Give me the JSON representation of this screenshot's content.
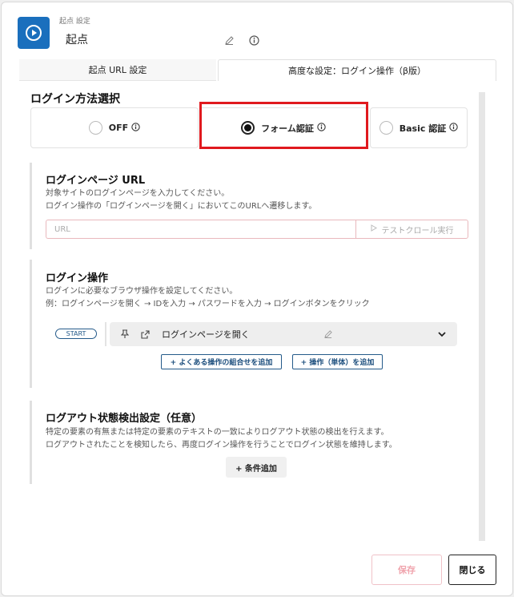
{
  "header": {
    "subtitle": "起点 設定",
    "title": "起点"
  },
  "tabs": [
    {
      "label": "起点 URL 設定"
    },
    {
      "label": "高度な設定：ログイン操作（β版）"
    }
  ],
  "login_method": {
    "title": "ログイン方法選択",
    "options": [
      {
        "label": "OFF",
        "selected": false
      },
      {
        "label": "フォーム認証",
        "selected": true
      },
      {
        "label": "Basic 認証",
        "selected": false
      }
    ]
  },
  "login_page": {
    "title": "ログインページ URL",
    "desc1": "対象サイトのログインページを入力してください。",
    "desc2": "ログイン操作の「ログインページを開く」においてこのURLへ遷移します。",
    "url_placeholder": "URL",
    "crawl_label": "テストクロール実行"
  },
  "login_ops": {
    "title": "ログイン操作",
    "desc1": "ログインに必要なブラウザ操作を設定してください。",
    "desc2": "例：ログインページを開く → IDを入力 → パスワードを入力 → ログインボタンをクリック",
    "start_label": "START",
    "step_label": "ログインページを開く",
    "add_combo_label": "+ よくある操作の組合せを追加",
    "add_single_label": "+ 操作（単体）を追加"
  },
  "logout": {
    "title": "ログアウト状態検出設定（任意）",
    "desc1": "特定の要素の有無または特定の要素のテキストの一致によりログアウト状態の検出を行えます。",
    "desc2": "ログアウトされたことを検知したら、再度ログイン操作を行うことでログイン状態を維持します。",
    "add_condition_label": "+ 条件追加"
  },
  "footer": {
    "save_label": "保存",
    "close_label": "閉じる"
  },
  "colors": {
    "brand": "#1a6fbd",
    "highlight": "#e0191e",
    "button_outline": "#245a8a"
  }
}
